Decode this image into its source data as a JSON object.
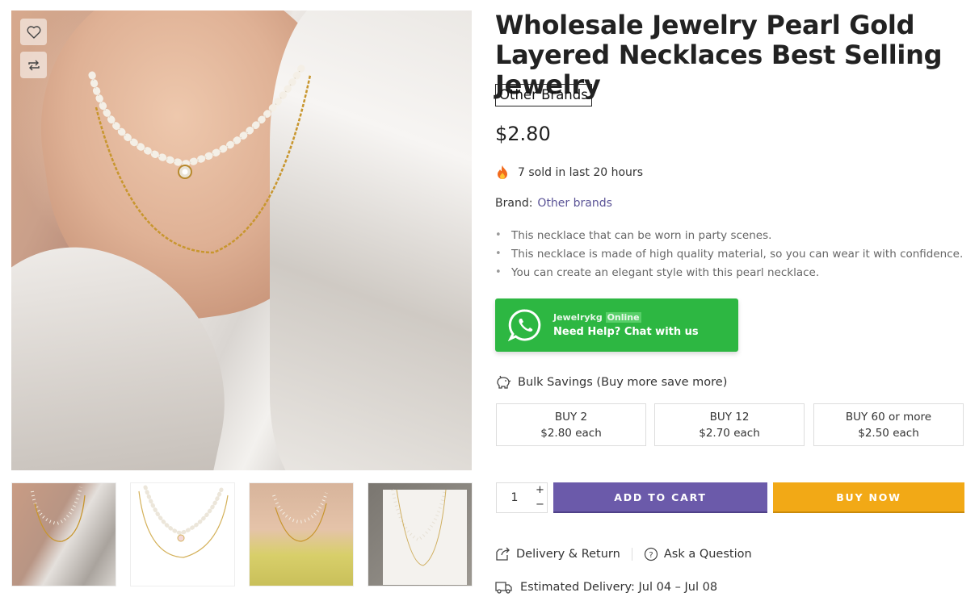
{
  "product": {
    "title": "Wholesale Jewelry Pearl Gold Layered Necklaces Best Selling Jewelry",
    "brand_tag": "Other Brands",
    "price": "$2.80",
    "sold_text": "7 sold in last 20 hours",
    "brand_label": "Brand:",
    "brand_link": "Other brands",
    "features": [
      "This necklace that can be worn in party scenes.",
      "This necklace is made of high quality material, so you can wear it with confidence.",
      "You can create an elegant style with this pearl necklace."
    ]
  },
  "gallery": {
    "wishlist_icon": "heart-icon",
    "compare_icon": "compare-arrows-icon",
    "thumbnail_count": 4
  },
  "whatsapp": {
    "name": "Jewelrykg",
    "status": "Online",
    "help_text": "Need Help? Chat with us",
    "color": "#2db742"
  },
  "bulk": {
    "title": "Bulk Savings (Buy more save more)",
    "tiers": [
      {
        "label": "BUY 2",
        "price": "$2.80 each"
      },
      {
        "label": "BUY 12",
        "price": "$2.70 each"
      },
      {
        "label": "BUY 60 or more",
        "price": "$2.50 each"
      }
    ]
  },
  "purchase": {
    "quantity": "1",
    "plus": "+",
    "minus": "−",
    "add_to_cart": "ADD TO CART",
    "buy_now": "BUY NOW",
    "cart_color": "#6b5aaa",
    "buy_color": "#f2a916"
  },
  "links": {
    "delivery_return": "Delivery & Return",
    "ask_question": "Ask a Question"
  },
  "delivery": {
    "estimated": "Estimated Delivery: Jul 04 – Jul 08"
  }
}
